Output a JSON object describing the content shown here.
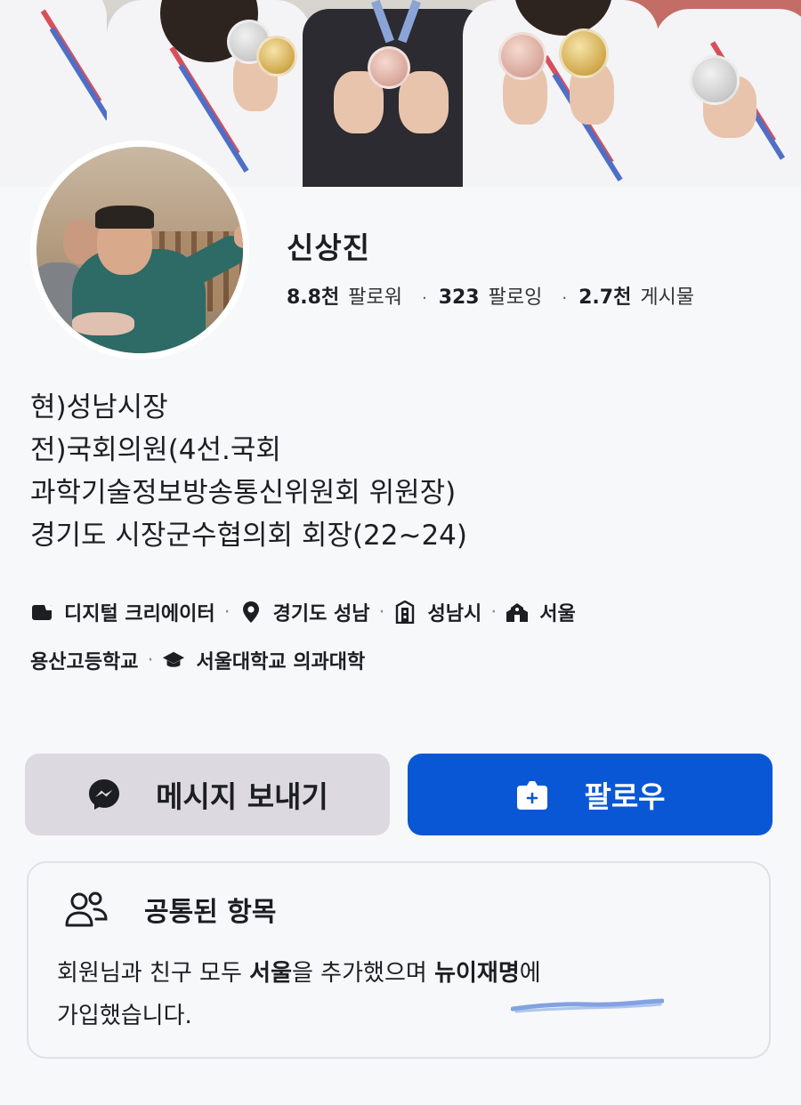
{
  "profile": {
    "name": "신상진",
    "stats": [
      {
        "value": "8.8천",
        "label": "팔로워"
      },
      {
        "value": "323",
        "label": "팔로잉"
      },
      {
        "value": "2.7천",
        "label": "게시물"
      }
    ],
    "bio": [
      "현)성남시장",
      "전)국회의원(4선.국회",
      "과학기술정보방송통신위원회 위원장)",
      "경기도 시장군수협의회 회장(22~24)"
    ],
    "details": {
      "category": "디지털 크리에이터",
      "location": "경기도 성남",
      "city": "성남시",
      "school": "서울",
      "school_cont": "용산고등학교",
      "university": "서울대학교 의과대학",
      "separator": "·"
    }
  },
  "actions": {
    "message_label": "메시지 보내기",
    "follow_label": "팔로우"
  },
  "mutual": {
    "title": "공통된 항목",
    "text_part1": "회원님과 친구 모두 ",
    "highlight1": "서울",
    "text_part2": "을 추가했으며 ",
    "highlight2": "뉴이재명",
    "text_part3": "에",
    "text_line2": "가입했습니다."
  },
  "colors": {
    "accent": "#0a57d6",
    "message_button": "#dcd9e0",
    "background": "#f7f8fa",
    "underline": "#5b86d8"
  },
  "icons": {
    "category": "clapperboard-icon",
    "location": "map-pin-icon",
    "city": "city-building-icon",
    "school": "school-icon",
    "university": "graduation-cap-icon",
    "message": "messenger-icon",
    "follow": "follow-plus-icon",
    "mutual": "people-icon"
  }
}
